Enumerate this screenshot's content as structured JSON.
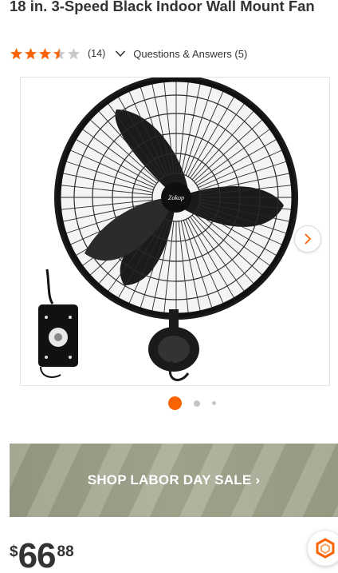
{
  "product": {
    "title": "18 in. 3-Speed Black Indoor Wall Mount Fan",
    "rating": 3.5,
    "rating_max": 5,
    "review_count": "(14)",
    "qa_label": "Questions & Answers (5)"
  },
  "media": {
    "image_description": "Black wall-mount fan with remote",
    "brand_badge": "Zokop",
    "carousel_active_index": 0,
    "carousel_dot_count": 3
  },
  "banner": {
    "label": "SHOP LABOR DAY SALE ›"
  },
  "price": {
    "currency": "$",
    "dollars": "66",
    "cents": "88"
  },
  "colors": {
    "accent": "#f96302",
    "star": "#f96302",
    "text": "#333333"
  }
}
